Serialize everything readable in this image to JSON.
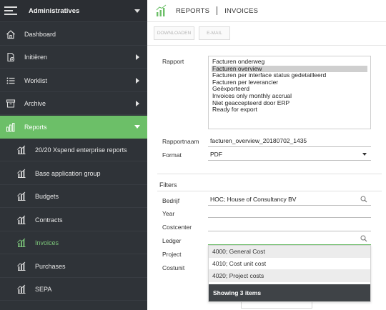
{
  "sidebar": {
    "title": "Administratives",
    "items": [
      {
        "label": "Dashboard",
        "icon": "home-icon"
      },
      {
        "label": "Initiëren",
        "icon": "new-document-icon"
      },
      {
        "label": "Worklist",
        "icon": "list-icon"
      },
      {
        "label": "Archive",
        "icon": "archive-icon"
      },
      {
        "label": "Reports",
        "icon": "bar-chart-icon"
      }
    ],
    "report_items": [
      {
        "label": "20/20 Xspend enterprise reports"
      },
      {
        "label": "Base application group"
      },
      {
        "label": "Budgets"
      },
      {
        "label": "Contracts"
      },
      {
        "label": "Invoices"
      },
      {
        "label": "Purchases"
      },
      {
        "label": "SEPA"
      }
    ],
    "active_color": "#6cbf68",
    "bg_color": "#2f3338"
  },
  "topbar": {
    "section": "REPORTS",
    "page": "INVOICES"
  },
  "toolbar": {
    "download_label": "DOWNLOADEN",
    "email_label": "E-MAIL"
  },
  "form": {
    "rapport_label": "Rapport",
    "rapport_options": [
      "Facturen onderweg",
      "Facturen overview",
      "Facturen per interface status gedetailleerd",
      "Facturen per leverancier",
      "Geëxporteerd",
      "Invoices only monthly accrual",
      "Niet geaccepteerd door ERP",
      "Ready for export"
    ],
    "rapport_selected": "Facturen overview",
    "rapportnaam_label": "Rapportnaam",
    "rapportnaam_value": "facturen_overview_20180702_1435",
    "format_label": "Format",
    "format_value": "PDF"
  },
  "filters": {
    "title": "Filters",
    "bedrijf_label": "Bedrijf",
    "bedrijf_value": "HOC; House of Consultancy BV",
    "year_label": "Year",
    "costcenter_label": "Costcenter",
    "ledger_label": "Ledger",
    "project_label": "Project",
    "costunit_label": "Costunit"
  },
  "ledger_dropdown": {
    "options": [
      "4000; General Cost",
      "4010; Cost unit cost",
      "4020; Project costs"
    ],
    "footer": "Showing 3 items"
  }
}
